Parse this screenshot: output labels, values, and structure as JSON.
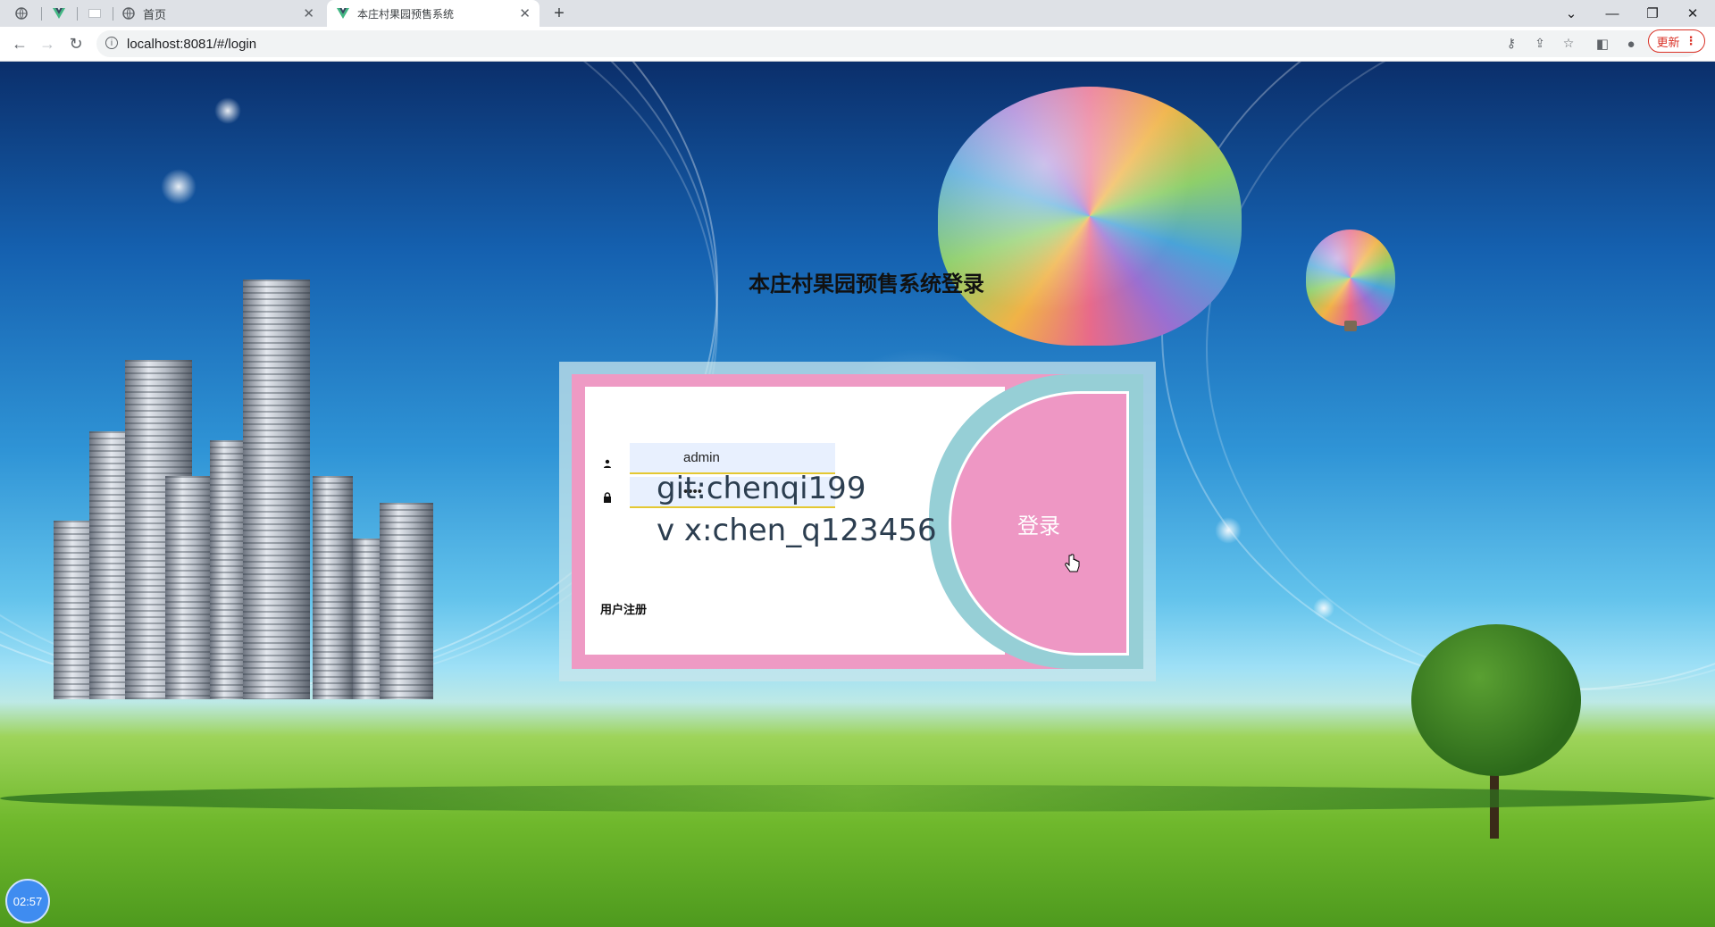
{
  "browser": {
    "tabs": [
      {
        "label": "首页",
        "icon": "globe-icon"
      },
      {
        "label": "本庄村果园预售系统",
        "icon": "vue-icon"
      }
    ],
    "url": "localhost:8081/#/login",
    "update_label": "更新"
  },
  "login": {
    "title": "本庄村果园预售系统登录",
    "username_value": "admin",
    "password_value": "••••",
    "overlay_line1": "git:chenqi199",
    "overlay_line2": "v x:chen_q123456",
    "login_button": "登录",
    "register_link": "用户注册"
  },
  "recording_timer": "02:57",
  "colors": {
    "frame_pink": "#ee9ac4",
    "frame_teal": "#96cfd6",
    "field_underline": "#e4c832"
  }
}
